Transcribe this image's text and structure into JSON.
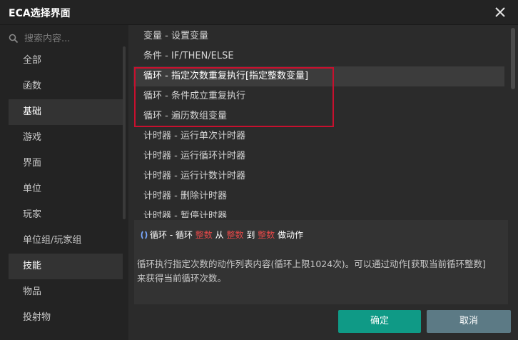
{
  "window": {
    "title": "ECA选择界面"
  },
  "search": {
    "placeholder": "搜索内容..."
  },
  "categories": [
    {
      "label": "全部"
    },
    {
      "label": "函数"
    },
    {
      "label": "基础",
      "active": true
    },
    {
      "label": "游戏"
    },
    {
      "label": "界面"
    },
    {
      "label": "单位"
    },
    {
      "label": "玩家"
    },
    {
      "label": "单位组/玩家组"
    },
    {
      "label": "技能",
      "active": true
    },
    {
      "label": "物品"
    },
    {
      "label": "投射物"
    }
  ],
  "actions": [
    {
      "label": "变量 - 设置变量"
    },
    {
      "label": "条件 - IF/THEN/ELSE"
    },
    {
      "label": "循环 - 指定次数重复执行[指定整数变量]",
      "hover": true
    },
    {
      "label": "循环 - 条件成立重复执行"
    },
    {
      "label": "循环 - 遍历数组变量"
    },
    {
      "label": "计时器 - 运行单次计时器"
    },
    {
      "label": "计时器 - 运行循环计时器"
    },
    {
      "label": "计时器 - 运行计数计时器"
    },
    {
      "label": "计时器 - 删除计时器"
    },
    {
      "label": "计时器 - 暂停计时器"
    }
  ],
  "detail": {
    "signature": {
      "prefix": "循环 - 循环",
      "param1": "整数",
      "from": "从",
      "param2": "整数",
      "to": "到",
      "param3": "整数",
      "suffix": "做动作"
    },
    "description": "循环执行指定次数的动作列表内容(循环上限1024次)。可以通过动作[获取当前循环整数]来获得当前循环次数。"
  },
  "buttons": {
    "confirm": "确定",
    "cancel": "取消"
  },
  "colors": {
    "highlight_border": "#c8102e",
    "confirm_bg": "#0f9a86",
    "cancel_bg": "#5c7a85",
    "keyword": "#e04848"
  }
}
